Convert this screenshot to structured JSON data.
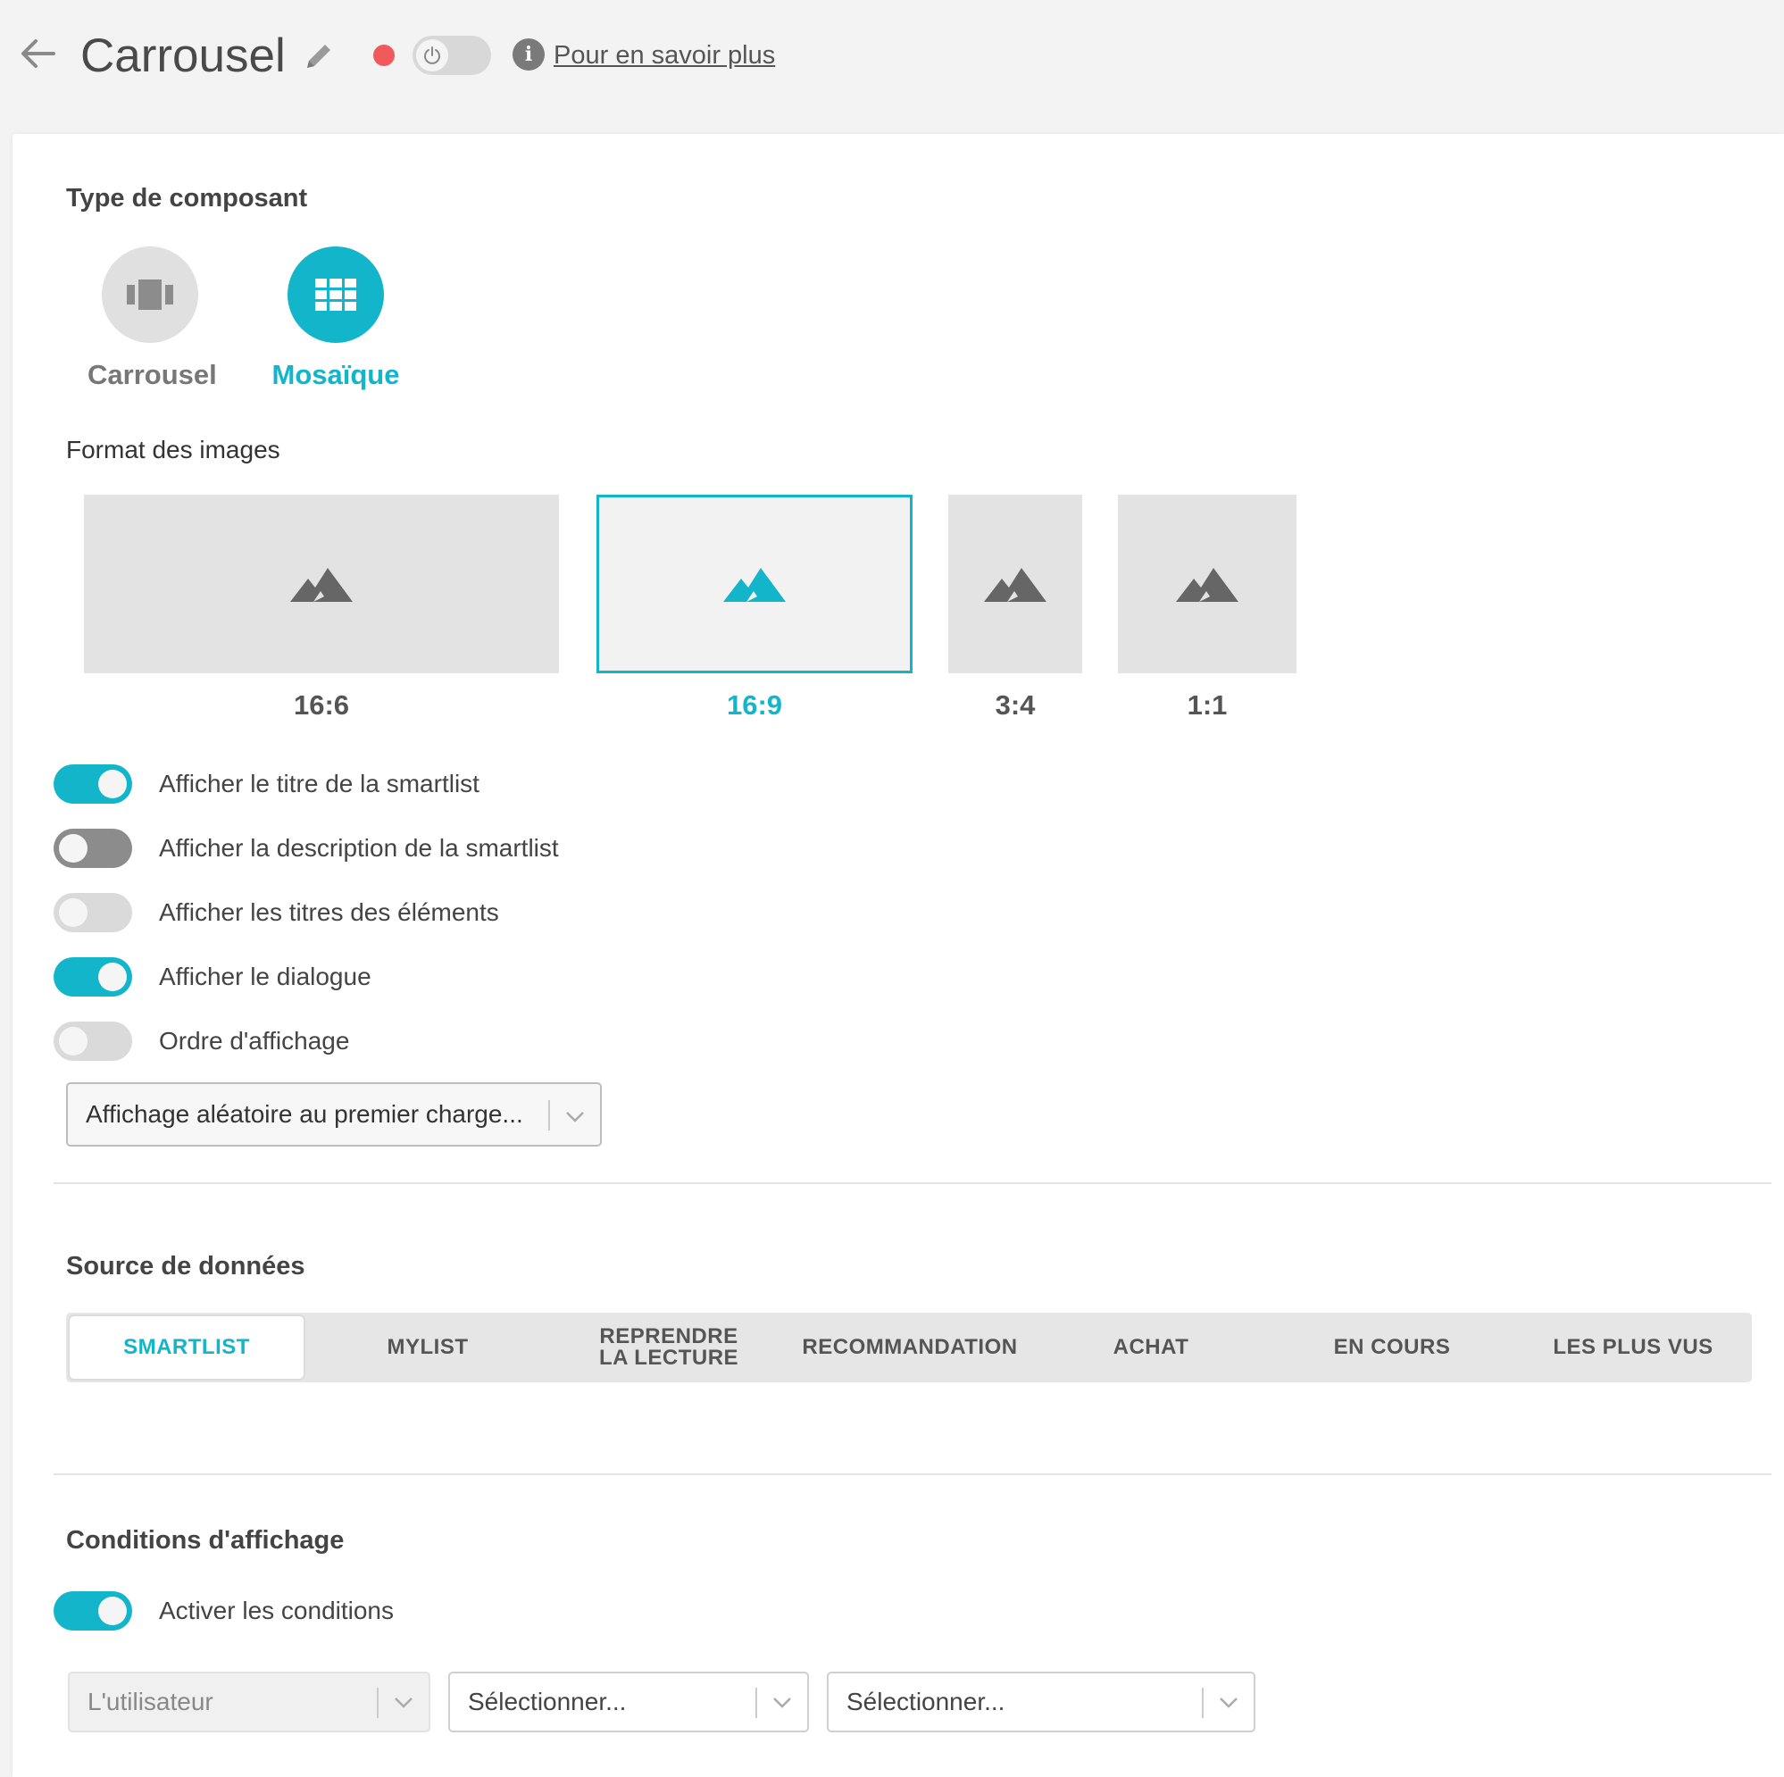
{
  "header": {
    "title": "Carrousel",
    "learn_more": "Pour en savoir plus",
    "status_color": "#f05a5a",
    "power_enabled": false
  },
  "component_type": {
    "heading": "Type de composant",
    "options": [
      {
        "label": "Carrousel",
        "icon": "carousel-icon",
        "selected": false
      },
      {
        "label": "Mosaïque",
        "icon": "grid-icon",
        "selected": true
      }
    ]
  },
  "image_format": {
    "heading": "Format des images",
    "options": [
      {
        "label": "16:6",
        "selected": false
      },
      {
        "label": "16:9",
        "selected": true
      },
      {
        "label": "3:4",
        "selected": false
      },
      {
        "label": "1:1",
        "selected": false
      }
    ]
  },
  "toggles": [
    {
      "label": "Afficher le titre de la smartlist",
      "state": "on"
    },
    {
      "label": "Afficher la description de la smartlist",
      "state": "off"
    },
    {
      "label": "Afficher les titres des éléments",
      "state": "off"
    },
    {
      "label": "Afficher le dialogue",
      "state": "on"
    },
    {
      "label": "Ordre d'affichage",
      "state": "off"
    }
  ],
  "display_order_select": {
    "value": "Affichage aléatoire au premier charge..."
  },
  "data_source": {
    "heading": "Source de données",
    "tabs": [
      "SMARTLIST",
      "MYLIST",
      "REPRENDRE LA LECTURE",
      "RECOMMANDATION",
      "ACHAT",
      "EN COURS",
      "LES PLUS VUS"
    ],
    "active_tab": "SMARTLIST"
  },
  "conditions": {
    "heading": "Conditions d'affichage",
    "toggle_label": "Activer les conditions",
    "toggle_state": "on",
    "selects": [
      {
        "value": "L'utilisateur",
        "disabled": true
      },
      {
        "value": "Sélectionner...",
        "disabled": false
      },
      {
        "value": "Sélectionner...",
        "disabled": false
      }
    ]
  },
  "colors": {
    "accent": "#12b5c9",
    "background": "#f3f3f3",
    "card": "#ffffff"
  }
}
